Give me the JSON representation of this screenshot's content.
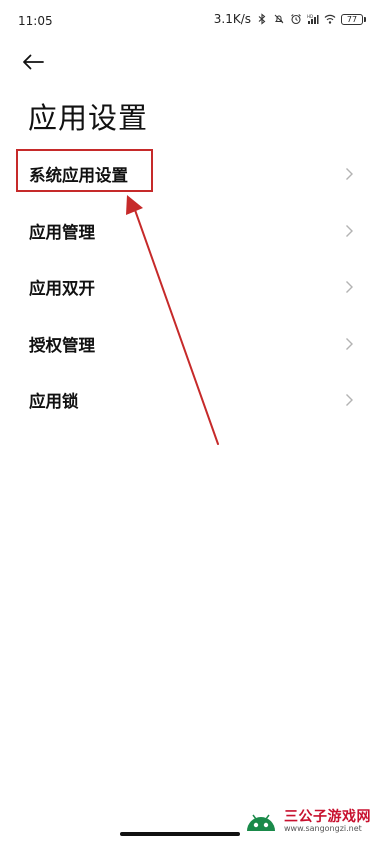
{
  "status_bar": {
    "time": "11:05",
    "net_speed": "3.1K/s",
    "hd_label": "HD",
    "battery_level": "77"
  },
  "header": {
    "back_icon": "arrow-left-icon",
    "title": "应用设置"
  },
  "menu": {
    "items": [
      {
        "label": "系统应用设置",
        "icon": "chevron-right-icon"
      },
      {
        "label": "应用管理",
        "icon": "chevron-right-icon"
      },
      {
        "label": "应用双开",
        "icon": "chevron-right-icon"
      },
      {
        "label": "授权管理",
        "icon": "chevron-right-icon"
      },
      {
        "label": "应用锁",
        "icon": "chevron-right-icon"
      }
    ]
  },
  "annotation": {
    "color": "#c62a2a"
  },
  "watermark": {
    "title": "三公子游戏网",
    "url": "www.sangongzi.net",
    "brand_color": "#c8102e",
    "logo_color": "#1a8a4a"
  }
}
